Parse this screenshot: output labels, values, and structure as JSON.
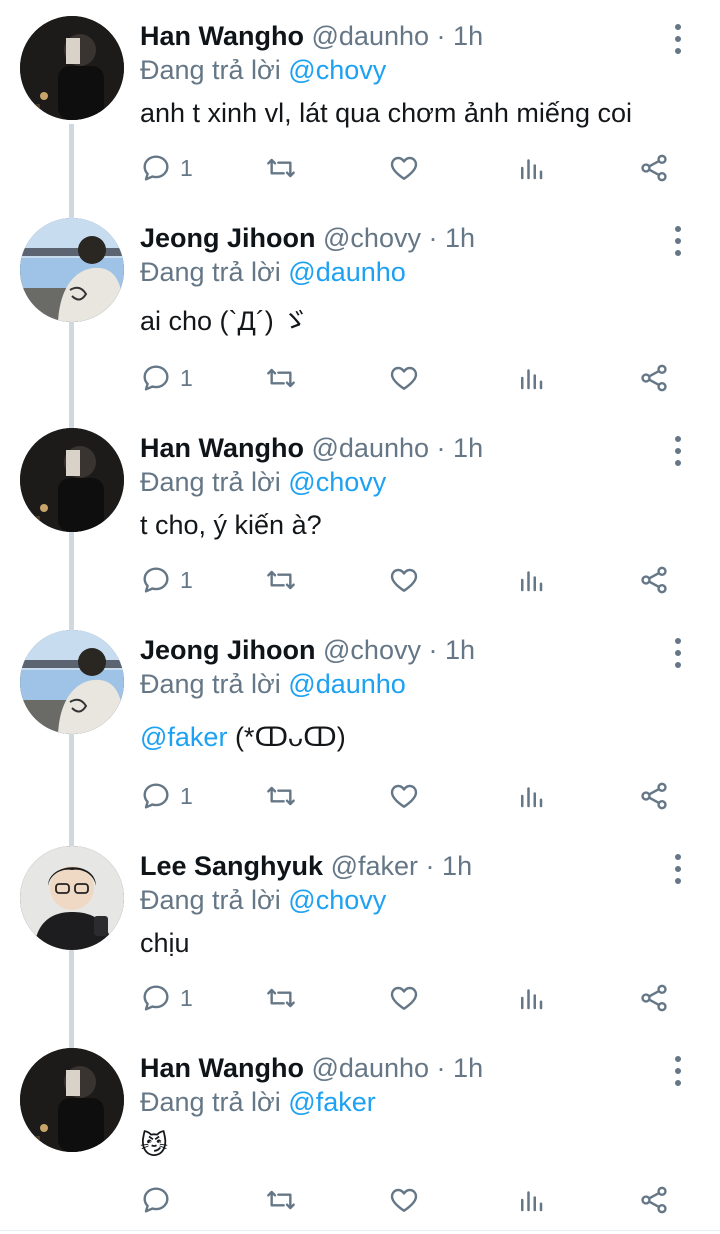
{
  "colors": {
    "accent": "#1da1f2",
    "muted": "#657786",
    "text": "#14171a",
    "thread": "#cfd9de"
  },
  "tweets": [
    {
      "name": "Han Wangho",
      "handle": "@daunho",
      "dot": "·",
      "time": "1h",
      "reply_prefix": "Đang trả lời",
      "reply_to": "@chovy",
      "content_text": "anh t xinh vl, lát qua chơm ảnh miếng coi",
      "reply_count": "1"
    },
    {
      "name": "Jeong Jihoon",
      "handle": "@chovy",
      "dot": "·",
      "time": "1h",
      "reply_prefix": "Đang trả lời",
      "reply_to": "@daunho",
      "content_text": "ai cho (`Д´) ゞ",
      "reply_count": "1"
    },
    {
      "name": "Han Wangho",
      "handle": "@daunho",
      "dot": "·",
      "time": "1h",
      "reply_prefix": "Đang trả lời",
      "reply_to": "@chovy",
      "content_text": "t cho, ý kiến à?",
      "reply_count": "1"
    },
    {
      "name": "Jeong Jihoon",
      "handle": "@chovy",
      "dot": "·",
      "time": "1h",
      "reply_prefix": "Đang trả lời",
      "reply_to": "@daunho",
      "content_mention": "@faker",
      "content_text": " (*ↀᴗↀ)",
      "reply_count": "1"
    },
    {
      "name": "Lee Sanghyuk",
      "handle": "@faker",
      "dot": "·",
      "time": "1h",
      "reply_prefix": "Đang trả lời",
      "reply_to": "@chovy",
      "content_text": "chịu",
      "reply_count": "1"
    },
    {
      "name": "Han Wangho",
      "handle": "@daunho",
      "dot": "·",
      "time": "1h",
      "reply_prefix": "Đang trả lời",
      "reply_to": "@faker",
      "content_text": "😼",
      "reply_count": ""
    }
  ],
  "icons": {
    "more": "more-vertical-icon",
    "reply": "reply-icon",
    "retweet": "retweet-icon",
    "like": "heart-icon",
    "analytics": "analytics-icon",
    "share": "share-icon"
  }
}
